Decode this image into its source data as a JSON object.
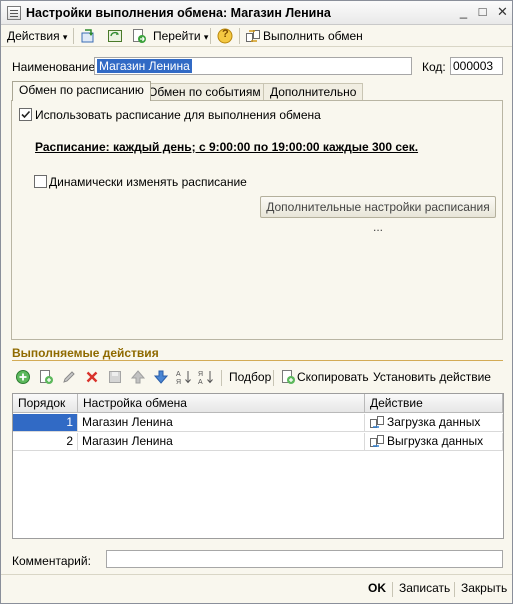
{
  "window": {
    "title": "Настройки выполнения обмена: Магазин Ленина",
    "minimize": "_",
    "maximize": "□",
    "close": "✕"
  },
  "toolbar": {
    "actions_label": "Действия",
    "goto_label": "Перейти",
    "help_label": "?",
    "execute_label": "Выполнить обмен",
    "dropdown_glyph": "▾"
  },
  "form": {
    "name_label": "Наименование:",
    "name_value": "Магазин Ленина",
    "code_label": "Код:",
    "code_value": "000003"
  },
  "tabs": [
    {
      "label": "Обмен по расписанию",
      "active": true
    },
    {
      "label": "Обмен по событиям",
      "active": false
    },
    {
      "label": "Дополнительно",
      "active": false
    }
  ],
  "schedule_tab": {
    "use_schedule_label": "Использовать расписание для выполнения обмена",
    "use_schedule_checked": true,
    "schedule_link": "Расписание: каждый  день; с 9:00:00 по 19:00:00 каждые 300 сек.",
    "dynamic_label": "Динамически изменять расписание",
    "dynamic_checked": false,
    "more_settings_button": "Дополнительные настройки расписания ..."
  },
  "actions_section": {
    "title": "Выполняемые действия",
    "toolbar": {
      "select_label": "Подбор",
      "copy_label": "Скопировать",
      "set_action_label": "Установить действие"
    },
    "columns": [
      "Порядок",
      "Настройка обмена",
      "Действие"
    ],
    "rows": [
      {
        "order": "1",
        "setting": "Магазин Ленина",
        "action": "Загрузка данных",
        "selected": true
      },
      {
        "order": "2",
        "setting": "Магазин Ленина",
        "action": "Выгрузка данных",
        "selected": false
      }
    ]
  },
  "comment": {
    "label": "Комментарий:",
    "value": ""
  },
  "footer": {
    "ok_label": "OK",
    "save_label": "Записать",
    "close_label": "Закрыть"
  },
  "colors": {
    "selection": "#316ac5",
    "section_title": "#8f6a00",
    "window_bg": "#f9f7ee"
  }
}
